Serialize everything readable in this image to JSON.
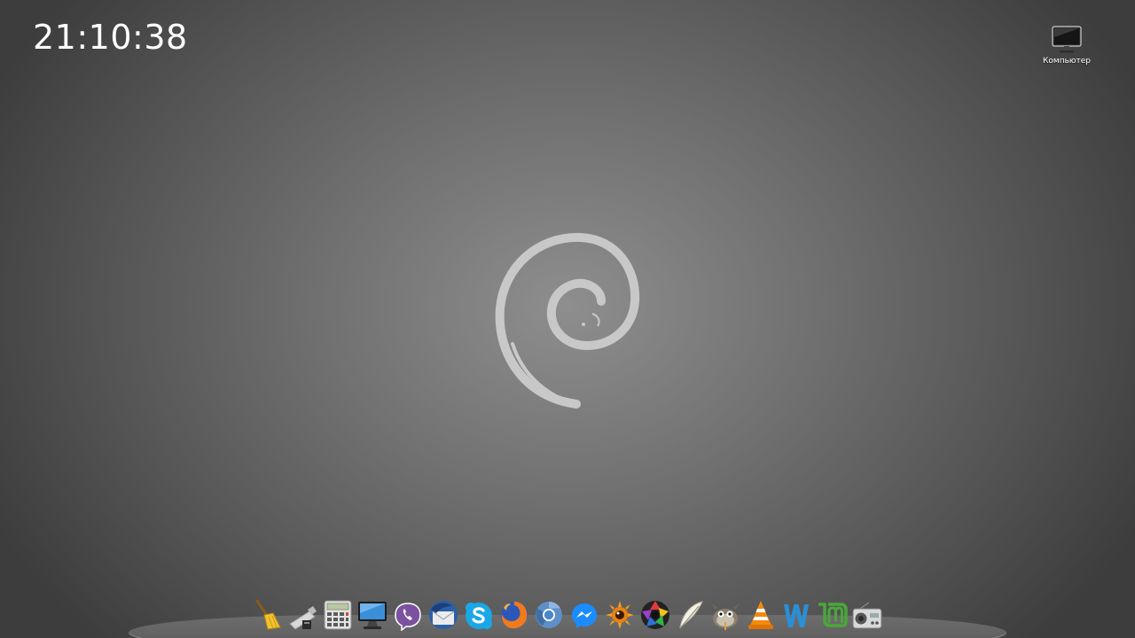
{
  "clock": {
    "time": "21:10:38"
  },
  "desktop": {
    "icons": [
      {
        "label": "Компьютер",
        "icon": "computer-icon"
      }
    ]
  },
  "wallpaper": {
    "logo": "debian-swirl-logo"
  },
  "dock": {
    "items": [
      {
        "icon": "broom-cleaner-icon"
      },
      {
        "icon": "usb-drive-icon"
      },
      {
        "icon": "calculator-icon"
      },
      {
        "icon": "monitor-icon"
      },
      {
        "icon": "viber-icon"
      },
      {
        "icon": "thunderbird-icon"
      },
      {
        "icon": "skype-icon"
      },
      {
        "icon": "firefox-icon"
      },
      {
        "icon": "chromium-icon"
      },
      {
        "icon": "messenger-icon"
      },
      {
        "icon": "image-viewer-icon"
      },
      {
        "icon": "aperture-icon"
      },
      {
        "icon": "feather-icon"
      },
      {
        "icon": "gimp-icon"
      },
      {
        "icon": "vlc-icon"
      },
      {
        "icon": "writer-w-icon"
      },
      {
        "icon": "linux-mint-icon"
      },
      {
        "icon": "radio-icon"
      }
    ]
  },
  "colors": {
    "background_center": "#8e8e8e",
    "background_edge": "#3d3d3d",
    "logo": "#c8c8c8",
    "clock_text": "#ffffff"
  }
}
